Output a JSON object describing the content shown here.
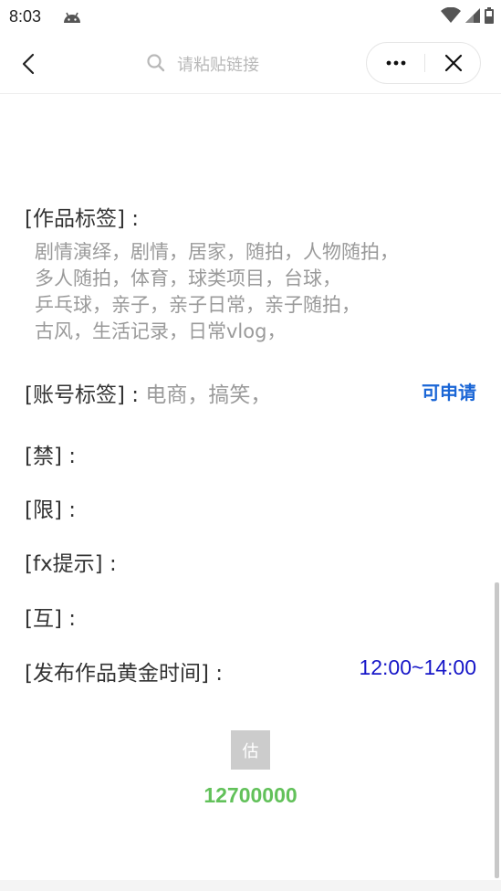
{
  "status_bar": {
    "time": "8:03"
  },
  "nav": {
    "search_placeholder": "请粘贴链接"
  },
  "content": {
    "work_tags_label": "[作品标签] :",
    "work_tags_lines": [
      "剧情演绎，剧情，居家，随拍，人物随拍，",
      "多人随拍，体育，球类项目，台球，",
      "乒乓球，亲子，亲子日常，亲子随拍，",
      "古风，生活记录，日常vlog，"
    ],
    "account_tags_label": "[账号标签] :",
    "account_tags_value": "电商，搞笑，",
    "apply_link": "可申请",
    "ban_label": "[禁] :",
    "limit_label": "[限] :",
    "fx_label": "[fx提示] :",
    "mutual_label": "[互] :",
    "golden_time_label": "[发布作品黄金时间] :",
    "golden_time_value": "12:00~14:00",
    "estimate_button": "估",
    "estimate_value": "12700000"
  },
  "colors": {
    "link_blue": "#1a66d6",
    "time_blue": "#1616c8",
    "value_green": "#62c15a",
    "muted_gray": "#9a9a9a"
  }
}
